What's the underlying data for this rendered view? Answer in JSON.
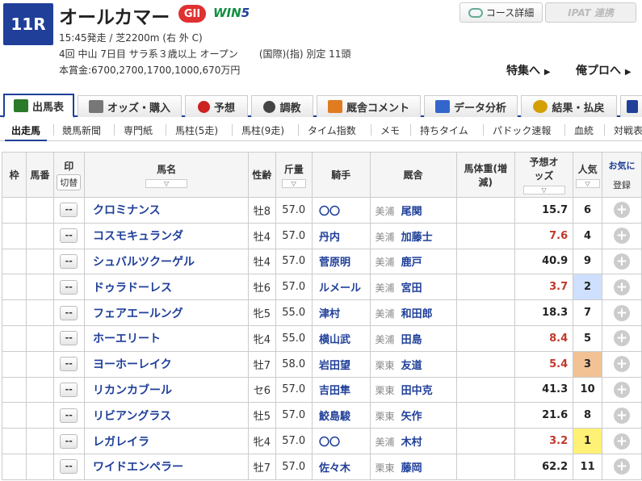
{
  "race": {
    "number": "11R",
    "name": "オールカマー",
    "grade": "GII",
    "win5": {
      "prefix": "WIN",
      "suffix": "5"
    },
    "line1": "15:45発走 / 芝2200m (右 外 C)",
    "line2a": "4回 中山 7日目 サラ系３歳以上 オープン",
    "line2b": "(国際)(指) 別定 11頭",
    "line3": "本賞金:6700,2700,1700,1000,670万円"
  },
  "buttons": {
    "course": "コース詳細",
    "ipat": "IPAT 連携"
  },
  "features": {
    "special": "特集へ",
    "pro": "俺プロへ"
  },
  "tabs": [
    {
      "label": "出馬表",
      "color": "#2a7a2a"
    },
    {
      "label": "オッズ・購入",
      "color": "#666666"
    },
    {
      "label": "予想",
      "color": "#cc2222"
    },
    {
      "label": "調教",
      "color": "#444444"
    },
    {
      "label": "厩舎コメント",
      "color": "#e07b20"
    },
    {
      "label": "データ分析",
      "color": "#3366cc"
    },
    {
      "label": "結果・払戻",
      "color": "#d4a000"
    },
    {
      "label": "",
      "color": "#1f3f99"
    }
  ],
  "subnav": [
    "出走馬",
    "競馬新聞",
    "専門紙",
    "馬柱(5走)",
    "馬柱(9走)",
    "タイム指数",
    "メモ",
    "持ちタイム",
    "パドック速報",
    "血統",
    "対戦表"
  ],
  "headers": {
    "waku": "枠",
    "uma": "馬番",
    "mark": "印",
    "mark_switch": "切替",
    "name": "馬名",
    "sex": "性齢",
    "weight": "斤量",
    "jockey": "騎手",
    "trainer": "厩舎",
    "bw": "馬体重(増減)",
    "odds": "予想オッズ",
    "pop": "人気",
    "reg_top": "お気に",
    "reg": "登録",
    "sort": "▽"
  },
  "colors": {
    "red_odds": "#c0392b",
    "pop1": "#fff176",
    "pop2": "#cfe0ff",
    "pop3": "#f2c295"
  },
  "horses": [
    {
      "name": "クロミナンス",
      "sex": "牡8",
      "weight": "57.0",
      "jockey": "〇〇",
      "region": "美浦",
      "trainer": "尾関",
      "odds": "15.7",
      "pop": "6",
      "mark": "--"
    },
    {
      "name": "コスモキュランダ",
      "sex": "牡4",
      "weight": "57.0",
      "jockey": "丹内",
      "region": "美浦",
      "trainer": "加藤士",
      "odds": "7.6",
      "pop": "4",
      "mark": "--"
    },
    {
      "name": "シュバルツクーゲル",
      "sex": "牡4",
      "weight": "57.0",
      "jockey": "菅原明",
      "region": "美浦",
      "trainer": "鹿戸",
      "odds": "40.9",
      "pop": "9",
      "mark": "--"
    },
    {
      "name": "ドゥラドーレス",
      "sex": "牡6",
      "weight": "57.0",
      "jockey": "ルメール",
      "region": "美浦",
      "trainer": "宮田",
      "odds": "3.7",
      "pop": "2",
      "mark": "--"
    },
    {
      "name": "フェアエールング",
      "sex": "牝5",
      "weight": "55.0",
      "jockey": "津村",
      "region": "美浦",
      "trainer": "和田郎",
      "odds": "18.3",
      "pop": "7",
      "mark": "--"
    },
    {
      "name": "ホーエリート",
      "sex": "牝4",
      "weight": "55.0",
      "jockey": "横山武",
      "region": "美浦",
      "trainer": "田島",
      "odds": "8.4",
      "pop": "5",
      "mark": "--"
    },
    {
      "name": "ヨーホーレイク",
      "sex": "牡7",
      "weight": "58.0",
      "jockey": "岩田望",
      "region": "栗東",
      "trainer": "友道",
      "odds": "5.4",
      "pop": "3",
      "mark": "--"
    },
    {
      "name": "リカンカブール",
      "sex": "セ6",
      "weight": "57.0",
      "jockey": "吉田隼",
      "region": "栗東",
      "trainer": "田中克",
      "odds": "41.3",
      "pop": "10",
      "mark": "--"
    },
    {
      "name": "リビアングラス",
      "sex": "牡5",
      "weight": "57.0",
      "jockey": "鮫島駿",
      "region": "栗東",
      "trainer": "矢作",
      "odds": "21.6",
      "pop": "8",
      "mark": "--"
    },
    {
      "name": "レガレイラ",
      "sex": "牝4",
      "weight": "57.0",
      "jockey": "〇〇",
      "region": "美浦",
      "trainer": "木村",
      "odds": "3.2",
      "pop": "1",
      "mark": "--"
    },
    {
      "name": "ワイドエンペラー",
      "sex": "牡7",
      "weight": "57.0",
      "jockey": "佐々木",
      "region": "栗東",
      "trainer": "藤岡",
      "odds": "62.2",
      "pop": "11",
      "mark": "--"
    }
  ]
}
